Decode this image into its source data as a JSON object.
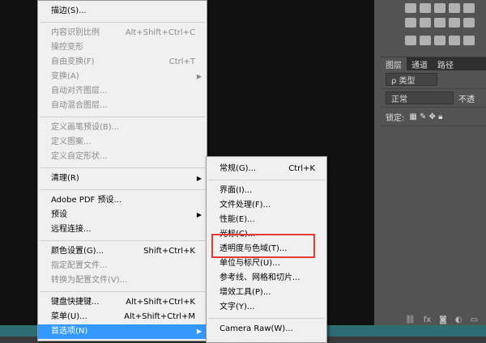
{
  "menu_main": {
    "groups": [
      [
        {
          "label": "描边(S)...",
          "shortcut": "",
          "enabled": true
        }
      ],
      [
        {
          "label": "内容识别比例",
          "shortcut": "Alt+Shift+Ctrl+C",
          "enabled": false
        },
        {
          "label": "操控变形",
          "shortcut": "",
          "enabled": false
        },
        {
          "label": "自由变换(F)",
          "shortcut": "Ctrl+T",
          "enabled": false
        },
        {
          "label": "变换(A)",
          "shortcut": "",
          "enabled": false,
          "submenu": true
        },
        {
          "label": "自动对齐图层...",
          "shortcut": "",
          "enabled": false
        },
        {
          "label": "自动混合图层...",
          "shortcut": "",
          "enabled": false
        }
      ],
      [
        {
          "label": "定义画笔预设(B)...",
          "shortcut": "",
          "enabled": false
        },
        {
          "label": "定义图案...",
          "shortcut": "",
          "enabled": false
        },
        {
          "label": "定义自定形状...",
          "shortcut": "",
          "enabled": false
        }
      ],
      [
        {
          "label": "清理(R)",
          "shortcut": "",
          "enabled": true,
          "submenu": true
        }
      ],
      [
        {
          "label": "Adobe PDF 预设...",
          "shortcut": "",
          "enabled": true
        },
        {
          "label": "预设",
          "shortcut": "",
          "enabled": true,
          "submenu": true
        },
        {
          "label": "远程连接...",
          "shortcut": "",
          "enabled": true
        }
      ],
      [
        {
          "label": "颜色设置(G)...",
          "shortcut": "Shift+Ctrl+K",
          "enabled": true
        },
        {
          "label": "指定配置文件...",
          "shortcut": "",
          "enabled": false
        },
        {
          "label": "转换为配置文件(V)...",
          "shortcut": "",
          "enabled": false
        }
      ],
      [
        {
          "label": "键盘快捷键...",
          "shortcut": "Alt+Shift+Ctrl+K",
          "enabled": true
        },
        {
          "label": "菜单(U)...",
          "shortcut": "Alt+Shift+Ctrl+M",
          "enabled": true
        },
        {
          "label": "首选项(N)",
          "shortcut": "",
          "enabled": true,
          "submenu": true,
          "selected": true
        }
      ]
    ]
  },
  "submenu_prefs": {
    "groups": [
      [
        {
          "label": "常规(G)...",
          "shortcut": "Ctrl+K"
        }
      ],
      [
        {
          "label": "界面(I)...",
          "shortcut": ""
        },
        {
          "label": "文件处理(F)...",
          "shortcut": ""
        },
        {
          "label": "性能(E)...",
          "shortcut": ""
        },
        {
          "label": "光标(C)...",
          "shortcut": ""
        },
        {
          "label": "透明度与色域(T)...",
          "shortcut": "",
          "highlighted": true
        },
        {
          "label": "单位与标尺(U)...",
          "shortcut": ""
        },
        {
          "label": "参考线、网格和切片...",
          "shortcut": ""
        },
        {
          "label": "增效工具(P)...",
          "shortcut": ""
        },
        {
          "label": "文字(Y)...",
          "shortcut": ""
        }
      ],
      [
        {
          "label": "Camera Raw(W)...",
          "shortcut": ""
        }
      ]
    ]
  },
  "layers_panel": {
    "tabs": [
      "图层",
      "通道",
      "路径"
    ],
    "filter_label": "ρ 类型",
    "blend_mode": "正常",
    "opacity_label": "不透",
    "lock_label": "锁定:"
  },
  "colors": {
    "highlight_border": "#e53935",
    "selection": "#3399ff"
  }
}
